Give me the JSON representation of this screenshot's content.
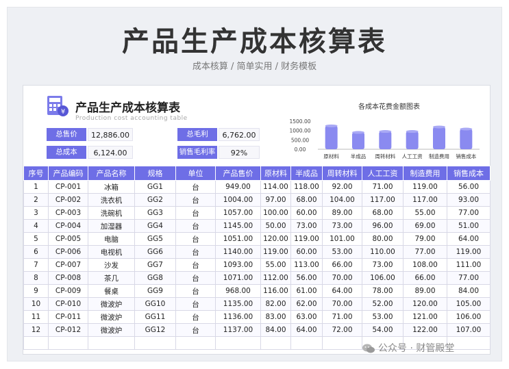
{
  "hero": {
    "title": "产品生产成本核算表",
    "subtitle": "成本核算 /  简单实用 / 财务模板"
  },
  "sheet": {
    "icon": "calculator-yen-icon",
    "title": "产品生产成本核算表",
    "subtitle": "Production cost accounting table",
    "kpis": {
      "total_sales_label": "总售价",
      "total_sales_value": "12,886.00",
      "gross_profit_label": "总毛利",
      "gross_profit_value": "6,762.00",
      "total_cost_label": "总成本",
      "total_cost_value": "6,124.00",
      "margin_label": "销售毛利率",
      "margin_value": "92%"
    }
  },
  "chart_data": {
    "type": "bar",
    "title": "各成本花费金额图表",
    "categories": [
      "原材料",
      "半成品",
      "周转材料",
      "人工工资",
      "制造费用",
      "销售成本"
    ],
    "values": [
      1250,
      900,
      950,
      950,
      1190,
      1080
    ],
    "ylim": [
      0,
      1500
    ],
    "yticks": [
      "1500.00",
      "1000.00",
      "500.00",
      "0.00"
    ],
    "grid": false,
    "color": "#8a8af0"
  },
  "table": {
    "headers": [
      "序号",
      "产品编码",
      "产品名称",
      "规格",
      "单位",
      "产品售价",
      "原材料",
      "半成品",
      "周转材料",
      "人工工资",
      "制造费用",
      "销售成本"
    ],
    "rows": [
      [
        "1",
        "CP-001",
        "冰箱",
        "GG1",
        "台",
        "949.00",
        "114.00",
        "118.00",
        "92.00",
        "71.00",
        "119.00",
        "56.00"
      ],
      [
        "2",
        "CP-002",
        "洗衣机",
        "GG2",
        "台",
        "1004.00",
        "97.00",
        "68.00",
        "104.00",
        "117.00",
        "117.00",
        "93.00"
      ],
      [
        "3",
        "CP-003",
        "洗碗机",
        "GG3",
        "台",
        "1057.00",
        "100.00",
        "60.00",
        "89.00",
        "68.00",
        "55.00",
        "77.00"
      ],
      [
        "4",
        "CP-004",
        "加湿器",
        "GG4",
        "台",
        "1145.00",
        "50.00",
        "73.00",
        "73.00",
        "96.00",
        "69.00",
        "51.00"
      ],
      [
        "5",
        "CP-005",
        "电脑",
        "GG5",
        "台",
        "1051.00",
        "120.00",
        "119.00",
        "101.00",
        "80.00",
        "79.00",
        "64.00"
      ],
      [
        "6",
        "CP-006",
        "电视机",
        "GG6",
        "台",
        "1140.00",
        "119.00",
        "60.00",
        "53.00",
        "110.00",
        "77.00",
        "119.00"
      ],
      [
        "7",
        "CP-007",
        "沙发",
        "GG7",
        "台",
        "1093.00",
        "55.00",
        "113.00",
        "66.00",
        "73.00",
        "108.00",
        "111.00"
      ],
      [
        "8",
        "CP-008",
        "茶几",
        "GG8",
        "台",
        "1071.00",
        "112.00",
        "56.00",
        "70.00",
        "106.00",
        "66.00",
        "77.00"
      ],
      [
        "9",
        "CP-009",
        "餐桌",
        "GG9",
        "台",
        "968.00",
        "116.00",
        "61.00",
        "64.00",
        "78.00",
        "89.00",
        "84.00"
      ],
      [
        "10",
        "CP-010",
        "微波炉",
        "GG10",
        "台",
        "1135.00",
        "82.00",
        "62.00",
        "70.00",
        "52.00",
        "120.00",
        "105.00"
      ],
      [
        "11",
        "CP-011",
        "微波炉",
        "GG11",
        "台",
        "1136.00",
        "83.00",
        "63.00",
        "71.00",
        "53.00",
        "121.00",
        "106.00"
      ],
      [
        "12",
        "CP-012",
        "微波炉",
        "GG12",
        "台",
        "1137.00",
        "84.00",
        "64.00",
        "72.00",
        "54.00",
        "122.00",
        "107.00"
      ]
    ],
    "empty_rows": 1
  },
  "watermark": {
    "icon": "wechat-icon",
    "text": "公众号 · 财管殿堂"
  },
  "colors": {
    "accent": "#6e6ee6",
    "bar": "#8a8af0",
    "title": "#333333"
  }
}
